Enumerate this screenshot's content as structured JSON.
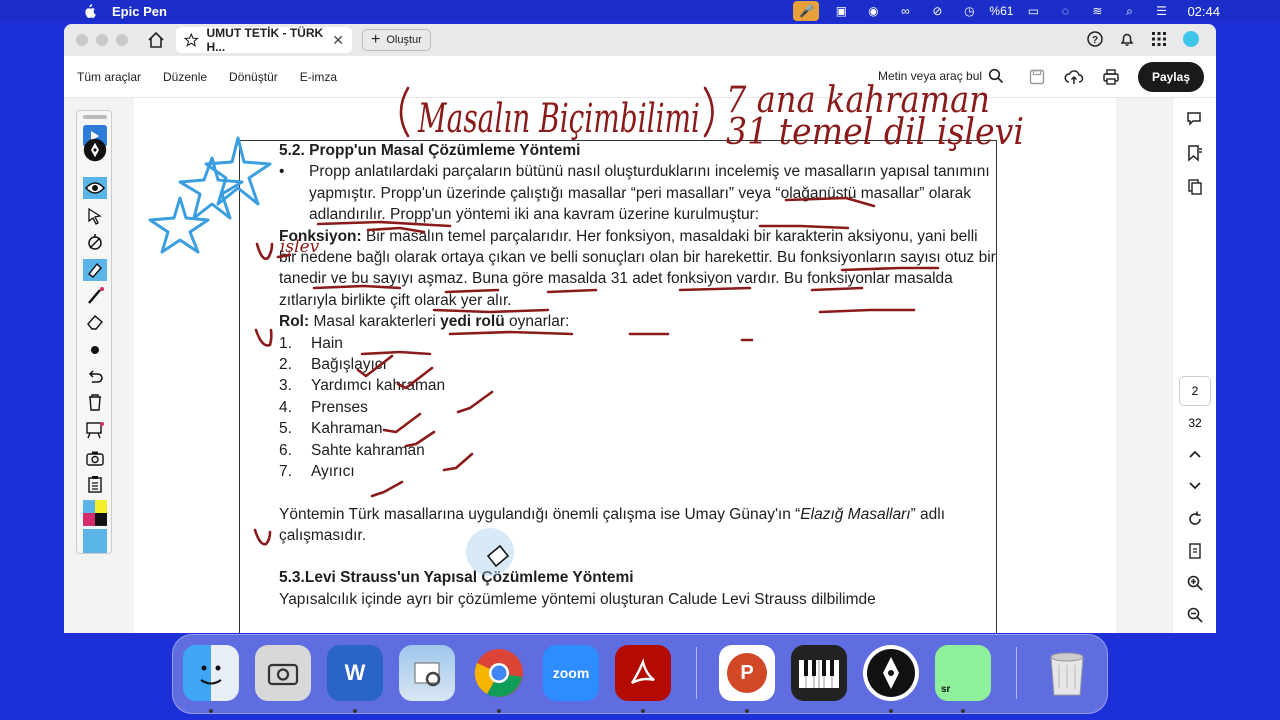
{
  "menubar": {
    "app_name": "Epic Pen",
    "battery": "%61",
    "clock": "02:44"
  },
  "browser": {
    "tab_title": "UMUT TETİK - TÜRK H...",
    "new_tab_label": "Oluştur"
  },
  "toolbar": {
    "menu": [
      "Tüm araçlar",
      "Düzenle",
      "Dönüştür",
      "E-imza"
    ],
    "search_label": "Metin veya araç bul",
    "share_label": "Paylaş"
  },
  "handwriting": {
    "line1": "(Masalın Biçimbilimi)  7 ana kahraman",
    "line2": "31 temel dil işlevi",
    "margin_note": "işlev"
  },
  "document": {
    "heading1": "5.2. Propp'un Masal Çözümleme Yöntemi",
    "bullet1": "Propp anlatılardaki parçaların bütünü nasıl oluşturduklarını incelemiş ve masalların yapısal tanımını yapmıştır. Propp'un üzerinde çalıştığı masallar “peri masalları” veya “olağanüstü masallar” olarak adlandırılır.  Propp'un yöntemi iki ana kavram üzerine kurulmuştur:",
    "fonksiyon_term": "Fonksiyon:",
    "fonksiyon_text": " Bir masalın temel parçalarıdır. Her fonksiyon, masaldaki bir karakterin aksiyonu, yani belli bir nedene bağlı olarak ortaya çıkan ve belli sonuçları olan bir harekettir. Bu fonksiyonların sayısı otuz bir tanedir ve bu sayıyı aşmaz. Buna göre masalda 31 adet fonksiyon vardır. Bu fonksiyonlar masalda zıtlarıyla birlikte çift olarak yer alır.",
    "rol_term": "Rol:",
    "rol_text_a": " Masal karakterleri ",
    "rol_bold": "yedi rolü",
    "rol_text_b": " oynarlar:",
    "roles": [
      {
        "n": "1.",
        "label": "Hain"
      },
      {
        "n": "2.",
        "label": "Bağışlayıcı"
      },
      {
        "n": "3.",
        "label": "Yardımcı kahraman"
      },
      {
        "n": "4.",
        "label": "Prenses"
      },
      {
        "n": "5.",
        "label": "Kahraman"
      },
      {
        "n": "6.",
        "label": "Sahte kahraman"
      },
      {
        "n": "7.",
        "label": "Ayırıcı"
      }
    ],
    "turk_text_a": "Yöntemin Türk masallarına uygulandığı önemli çalışma ise Umay Günay'ın “",
    "turk_italic": "Elazığ Masalları",
    "turk_text_b": "” adlı çalışmasıdır.",
    "heading2": "5.3.Levi Strauss'un Yapısal Çözümleme Yöntemi",
    "last_line": "Yapısalcılık içinde ayrı bir çözümleme yöntemi oluşturan Calude Levi Strauss dilbilimde"
  },
  "page_nav": {
    "current": "2",
    "total": "32"
  },
  "colors": {
    "ink_red": "#8b1a1a",
    "ink_blue": "#3a9ee0",
    "desktop": "#1d2fd6",
    "share_btn": "#1a1a1a"
  },
  "dock": [
    {
      "name": "Finder",
      "icon": "finder-icon"
    },
    {
      "name": "Screenshot",
      "icon": "camera-icon"
    },
    {
      "name": "Word",
      "icon": "word-icon",
      "label": "W"
    },
    {
      "name": "Preview",
      "icon": "preview-icon"
    },
    {
      "name": "Chrome",
      "icon": "chrome-icon"
    },
    {
      "name": "Zoom",
      "icon": "zoom-icon",
      "label": "zoom"
    },
    {
      "name": "Acrobat",
      "icon": "acrobat-icon"
    },
    {
      "name": "PowerPoint",
      "icon": "powerpoint-icon",
      "label": "P"
    },
    {
      "name": "Piano",
      "icon": "piano-icon"
    },
    {
      "name": "Epic Pen",
      "icon": "epic-pen-icon"
    },
    {
      "name": "Scene Runner",
      "icon": "sr-icon",
      "label": "sr"
    },
    {
      "name": "Trash",
      "icon": "trash-icon"
    }
  ]
}
